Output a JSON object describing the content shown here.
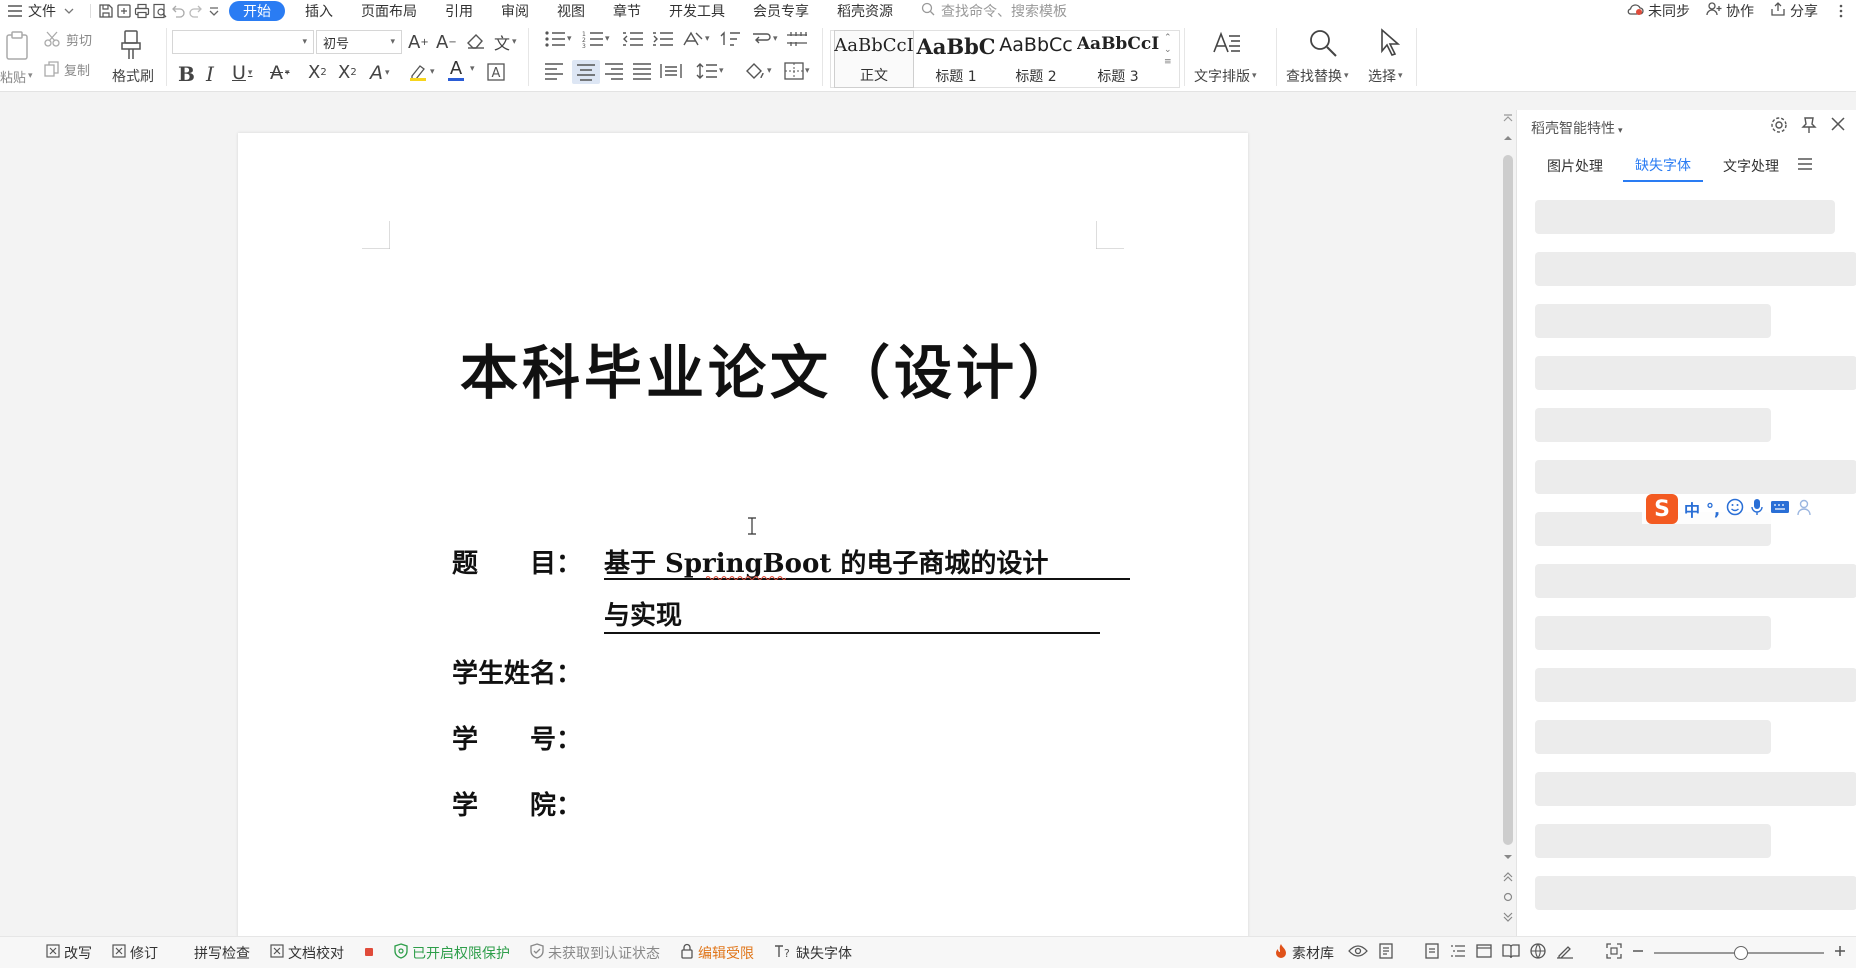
{
  "menubar": {
    "file_label": "文件",
    "tabs": [
      "开始",
      "插入",
      "页面布局",
      "引用",
      "审阅",
      "视图",
      "章节",
      "开发工具",
      "会员专享",
      "稻壳资源"
    ],
    "search_placeholder": "查找命令、搜索模板",
    "sync_label": "未同步",
    "collab_label": "协作",
    "share_label": "分享"
  },
  "ribbon": {
    "paste_label": "粘贴",
    "cut_label": "剪切",
    "copy_label": "复制",
    "format_painter_label": "格式刷",
    "font_name": "",
    "font_size": "初号",
    "styles": [
      {
        "sample": "AaBbCcI",
        "name": "正文"
      },
      {
        "sample": "AaBbC",
        "name": "标题 1"
      },
      {
        "sample": "AaBbCc",
        "name": "标题 2"
      },
      {
        "sample": "AaBbCcI",
        "name": "标题 3"
      }
    ],
    "text_layout_label": "文字排版",
    "find_replace_label": "查找替换",
    "select_label": "选择"
  },
  "document": {
    "title": "本科毕业论文（设计）",
    "fields": [
      {
        "label": "题　　目：",
        "value_line1": "基于 SpringBoot 的电子商城的设计",
        "value_line2": "与实现"
      },
      {
        "label": "学生姓名："
      },
      {
        "label": "学　　号："
      },
      {
        "label": "学　　院："
      }
    ]
  },
  "panel": {
    "title": "稻壳智能特性",
    "tabs": [
      "图片处理",
      "缺失字体",
      "文字处理"
    ],
    "active_tab": "缺失字体"
  },
  "ime": {
    "logo": "S",
    "mode": "中"
  },
  "statusbar": {
    "rewrite": "改写",
    "revise": "修订",
    "spellcheck": "拼写检查",
    "proofread": "文档校对",
    "protection": "已开启权限保护",
    "cert": "未获取到认证状态",
    "edit_limited": "编辑受限",
    "missing_font": "缺失字体",
    "material": "素材库"
  },
  "colors": {
    "accent": "#2a7cf3",
    "green": "#2e9e4a",
    "orange": "#e0761a",
    "ime_logo": "#f35a21"
  }
}
